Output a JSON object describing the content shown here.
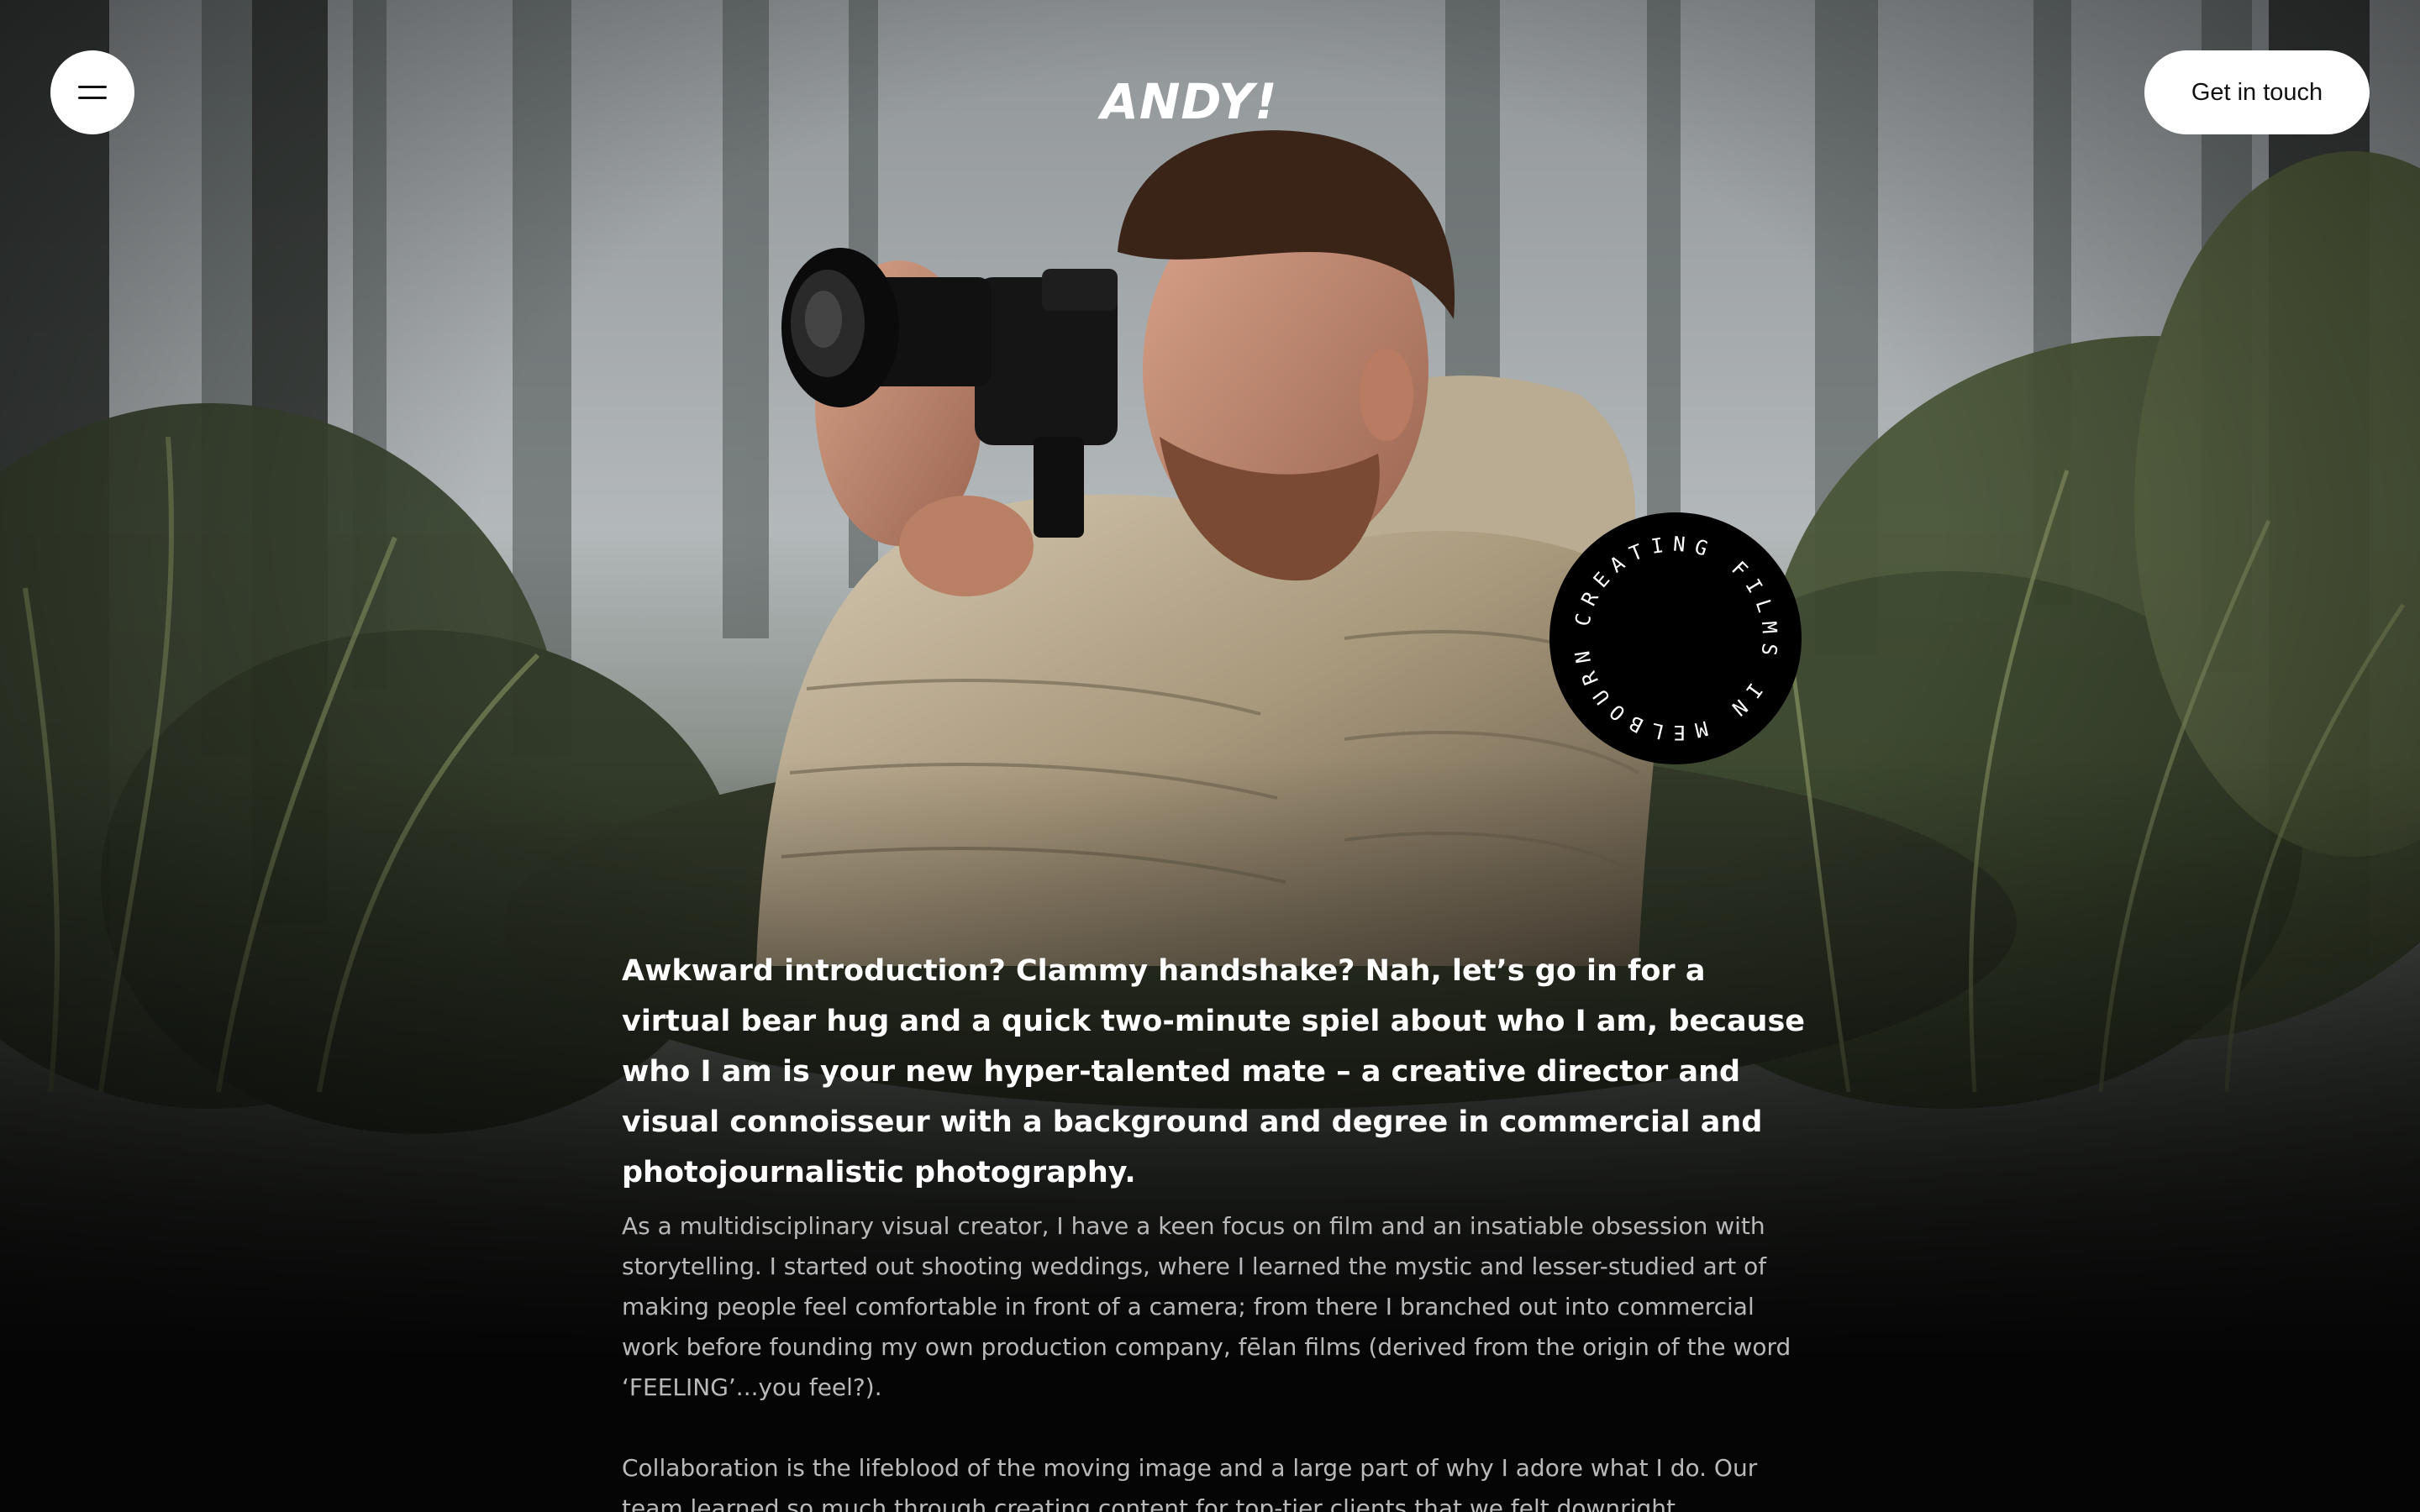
{
  "header": {
    "menu_icon": "hamburger-menu-icon",
    "logo_text": "ANDY!",
    "cta_label": "Get in touch"
  },
  "badge": {
    "circular_text": "CREATING FILMS IN MELBOURNE - ",
    "background_color": "#000000",
    "text_color": "#ffffff"
  },
  "content": {
    "intro": "Awkward introduction? Clammy handshake? Nah, let’s go in for a virtual bear hug and a quick two-minute spiel about who I am, because who I am is your new hyper-talented mate – a creative director and visual connoisseur with a background and degree in commercial and photojournalistic photography.",
    "paragraphs": [
      "As a multidisciplinary visual creator, I have a keen focus on film and an insatiable obsession with storytelling. I started out shooting weddings, where I learned the mystic and lesser-studied art of making people feel comfortable in front of a camera; from there I branched out into commercial work before founding my own production company, fēlan films (derived from the origin of the word ‘FEELING’...you feel?).",
      "Collaboration is the lifeblood of the moving image and a large part of why I adore what I do. Our team learned so much through creating content for top-tier clients that we felt downright"
    ]
  },
  "colors": {
    "page_background": "#050505",
    "button_background": "#ffffff",
    "intro_text": "#ffffff",
    "body_text": "#b9b9b9"
  }
}
